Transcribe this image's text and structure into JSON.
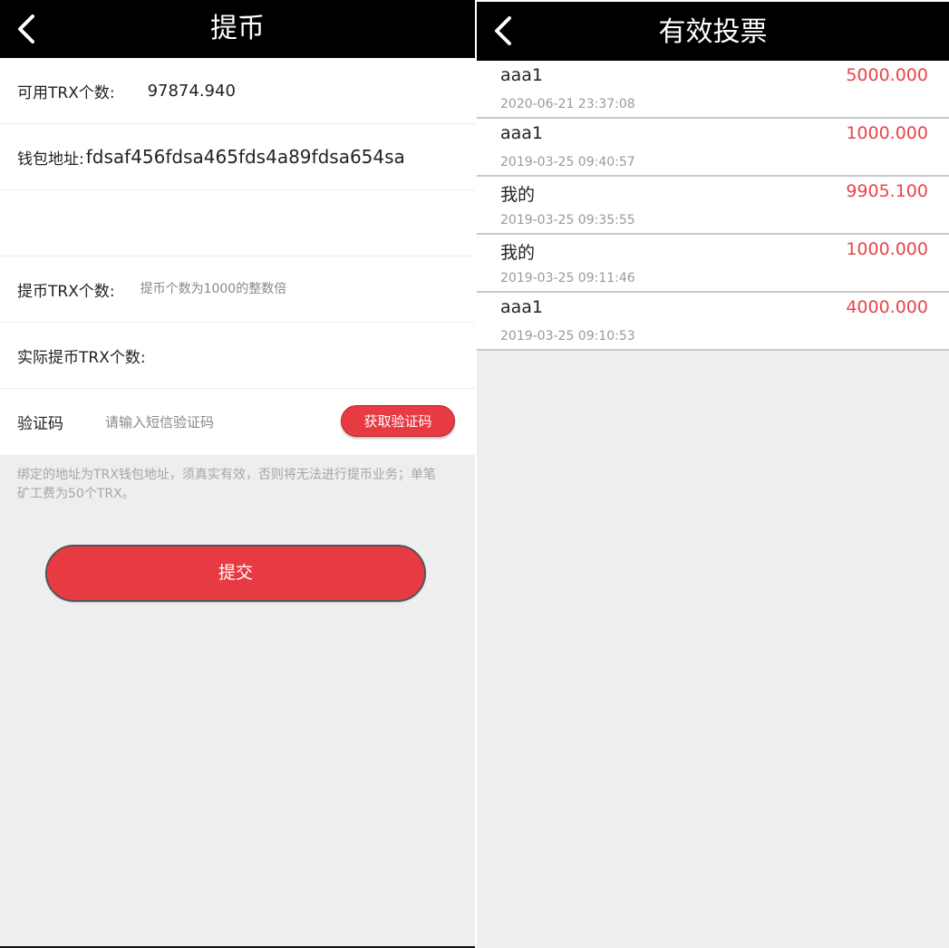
{
  "colors": {
    "accent": "#e83a42",
    "header_bg": "#000000",
    "page_bg": "#eeeeee",
    "amount": "#e8454a"
  },
  "left": {
    "header": {
      "title": "提币",
      "back_icon": "chevron-left-icon"
    },
    "available": {
      "label": "可用TRX个数:",
      "value": "97874.940"
    },
    "wallet": {
      "label": "钱包地址:",
      "value": "fdsaf456fdsa465fds4a89fdsa654sa"
    },
    "withdraw": {
      "label": "提币TRX个数:",
      "placeholder": "提币个数为1000的整数倍"
    },
    "actual": {
      "label": "实际提币TRX个数:"
    },
    "code": {
      "label": "验证码",
      "placeholder": "请输入短信验证码",
      "button": "获取验证码"
    },
    "notice": "绑定的地址为TRX钱包地址，须真实有效，否则将无法进行提币业务；单笔矿工费为50个TRX。",
    "submit": "提交"
  },
  "right": {
    "header": {
      "title": "有效投票",
      "back_icon": "chevron-left-icon"
    },
    "votes": [
      {
        "name": "aaa1",
        "amount": "5000.000",
        "time": "2020-06-21 23:37:08"
      },
      {
        "name": "aaa1",
        "amount": "1000.000",
        "time": "2019-03-25 09:40:57"
      },
      {
        "name": "我的",
        "amount": "9905.100",
        "time": "2019-03-25 09:35:55"
      },
      {
        "name": "我的",
        "amount": "1000.000",
        "time": "2019-03-25 09:11:46"
      },
      {
        "name": "aaa1",
        "amount": "4000.000",
        "time": "2019-03-25 09:10:53"
      }
    ]
  }
}
